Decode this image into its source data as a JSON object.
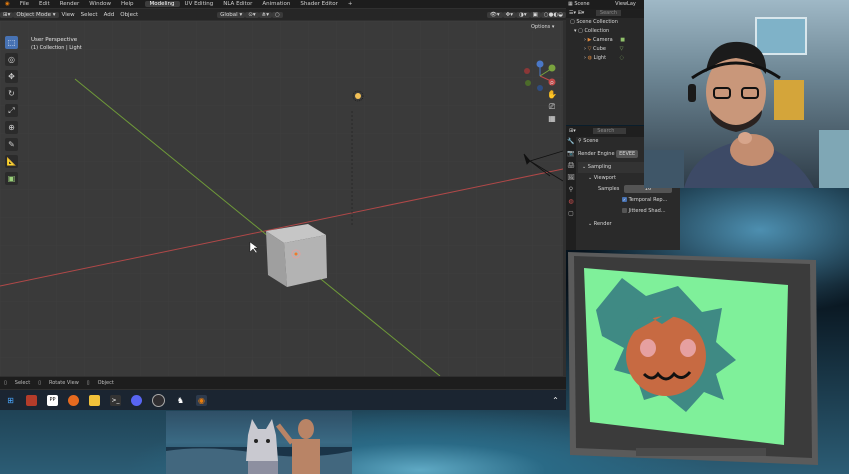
{
  "topbar": {
    "menus": [
      "File",
      "Edit",
      "Render",
      "Window",
      "Help"
    ],
    "workspaces": [
      "Modeling",
      "UV Editing",
      "NLA Editor",
      "Animation",
      "Shader Editor"
    ],
    "active_workspace": "Modeling",
    "add_tab": "+",
    "scene_label": "Scene",
    "viewlayer_label": "ViewLay"
  },
  "header": {
    "mode": "Object Mode",
    "menus": [
      "View",
      "Select",
      "Add",
      "Object"
    ],
    "orientation": "Global",
    "options": "Options"
  },
  "viewport": {
    "perspective": "User Perspective",
    "collection": "(1) Collection | Light"
  },
  "statusbar": {
    "items": [
      "Select",
      "Rotate View",
      "Object"
    ]
  },
  "outliner": {
    "search_placeholder": "Search",
    "root": "Scene Collection",
    "collection": "Collection",
    "items": [
      "Camera",
      "Cube",
      "Light"
    ]
  },
  "properties": {
    "search_placeholder": "Search",
    "scene": "Scene",
    "render_engine_label": "Render Engine",
    "render_engine": "EEVEE",
    "sampling": "Sampling",
    "viewport": "Viewport",
    "samples_label": "Samples",
    "samples": "16",
    "temporal": "Temporal Rep...",
    "jittered": "Jittered Shad...",
    "render": "Render"
  },
  "colors": {
    "selected_tool": "#4772b3",
    "x_axis": "#c24a4a",
    "y_axis": "#7aa33e",
    "tv_screen": "#7ff09a"
  }
}
